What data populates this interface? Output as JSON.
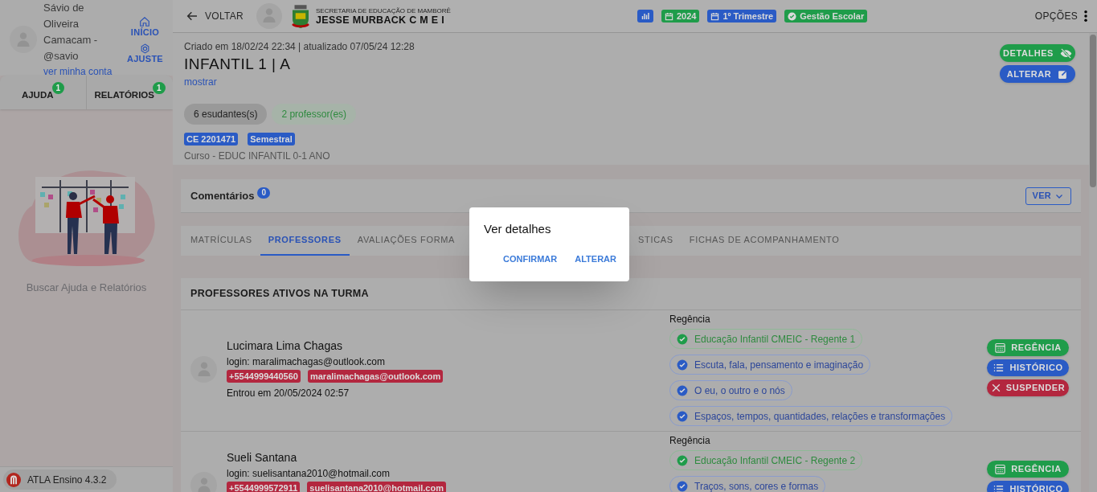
{
  "sidebar": {
    "user_name": "Sávio de Oliveira Camacam - @savio",
    "account_link": "ver minha conta",
    "nav": [
      {
        "kind": "home",
        "label": "INÍCIO"
      },
      {
        "kind": "settings",
        "label": "AJUSTE"
      }
    ],
    "tabs": [
      {
        "label": "AJUDA",
        "badge": "1"
      },
      {
        "label": "RELATÓRIOS",
        "badge": "1"
      }
    ],
    "empty_text": "Buscar Ajuda e Relatórios",
    "version": "ATLA Ensino 4.3.2"
  },
  "header": {
    "back": "VOLTAR",
    "org_subtitle": "SECRETARIA DE EDUCAÇÃO DE MAMBORÊ",
    "org_name": "JESSE MURBACK C M E I",
    "chips": [
      {
        "kind": "chart",
        "color": "#2a5bc5"
      },
      {
        "kind": "calendar",
        "label": "2024",
        "color": "#1f9c4a"
      },
      {
        "kind": "calendar",
        "label": "1º Trimestre",
        "color": "#2a5bc5"
      },
      {
        "kind": "check",
        "label": "Gestão Escolar",
        "color": "#1f9c4a"
      }
    ],
    "options": "OPÇÕES"
  },
  "class_info": {
    "meta": "Criado em 18/02/24 22:34 | atualizado 07/05/24 12:28",
    "title": "INFANTIL 1 | A",
    "show_link": "mostrar",
    "counts": [
      {
        "kind": "students",
        "label": "6 esudantes(s)"
      },
      {
        "kind": "teachers",
        "label": "2 professor(es)"
      }
    ],
    "tags": [
      "CE 2201471",
      "Semestral"
    ],
    "course": "Curso - EDUC INFANTIL 0-1 ANO",
    "buttons": [
      {
        "kind": "details",
        "label": "DETALHES"
      },
      {
        "kind": "edit",
        "label": "ALTERAR"
      }
    ]
  },
  "comments": {
    "label": "Comentários",
    "count": "0",
    "button": "VER"
  },
  "tabs": [
    {
      "label": "MATRÍCULAS",
      "selected": false
    },
    {
      "label": "PROFESSORES",
      "selected": true
    },
    {
      "label": "AVALIAÇÕES FORMA",
      "selected": false
    },
    {
      "label": "STICAS",
      "selected": false
    },
    {
      "label": "FICHAS DE ACOMPANHAMENTO",
      "selected": false
    }
  ],
  "professors": {
    "title": "PROFESSORES ATIVOS NA TURMA",
    "rows": [
      {
        "name": "Lucimara Lima Chagas",
        "login": "login: maralimachagas@outlook.com",
        "phone": "+5544999440560",
        "email": "maralimachagas@outlook.com",
        "entered": "Entrou em 20/05/2024 02:57",
        "section_label": "Regência",
        "subjects": [
          {
            "kind": "main",
            "label": "Educação Infantil CMEIC - Regente 1"
          },
          {
            "kind": "area",
            "label": "Escuta, fala, pensamento e imaginação"
          },
          {
            "kind": "area",
            "label": "O eu, o outro e o nós"
          },
          {
            "kind": "area",
            "label": "Espaços, tempos, quantidades, relações e transformações"
          }
        ],
        "actions": [
          {
            "kind": "regencia",
            "label": "REGÊNCIA"
          },
          {
            "kind": "history",
            "label": "HISTÓRICO"
          },
          {
            "kind": "suspend",
            "label": "SUSPENDER"
          }
        ]
      },
      {
        "name": "Sueli Santana",
        "login": "login: suelisantana2010@hotmail.com",
        "phone": "+5544999572911",
        "email": "suelisantana2010@hotmail.com",
        "section_label": "Regência",
        "subjects": [
          {
            "kind": "main",
            "label": "Educação Infantil CMEIC - Regente 2"
          },
          {
            "kind": "area",
            "label": "Traços, sons, cores e formas"
          }
        ],
        "actions": [
          {
            "kind": "regencia",
            "label": "REGÊNCIA"
          },
          {
            "kind": "history",
            "label": "HISTÓRICO"
          }
        ]
      }
    ]
  },
  "dialog": {
    "title": "Ver detalhes",
    "buttons": [
      "CONFIRMAR",
      "ALTERAR"
    ]
  }
}
